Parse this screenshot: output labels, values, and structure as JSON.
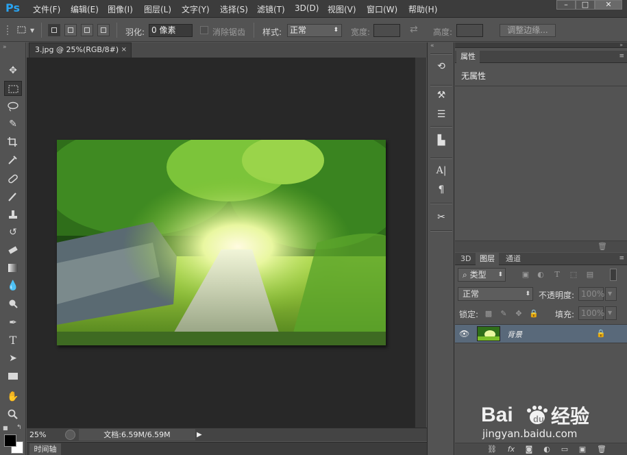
{
  "app": {
    "logo": "Ps"
  },
  "menu": [
    "文件(F)",
    "编辑(E)",
    "图像(I)",
    "图层(L)",
    "文字(Y)",
    "选择(S)",
    "滤镜(T)",
    "3D(D)",
    "视图(V)",
    "窗口(W)",
    "帮助(H)"
  ],
  "options": {
    "feather_label": "羽化:",
    "feather_value": "0 像素",
    "antialias_label": "消除锯齿",
    "style_label": "样式:",
    "style_value": "正常",
    "width_label": "宽度:",
    "height_label": "高度:",
    "refine_edge_button": "调整边缘..."
  },
  "document": {
    "tab_title": "3.jpg @ 25%(RGB/8#)",
    "close_glyph": "×",
    "image_desc_icon": "landscape-image",
    "zoom": "25%",
    "doc_size": "文档:6.59M/6.59M",
    "timeline_tab": "时间轴"
  },
  "properties_panel": {
    "tab": "属性",
    "empty_text": "无属性"
  },
  "layers_panel": {
    "tabs": [
      "3D",
      "图层",
      "通道"
    ],
    "filter_kind": "类型",
    "blend_mode": "正常",
    "opacity_label": "不透明度:",
    "opacity_value": "100%",
    "lock_label": "锁定:",
    "fill_label": "填充:",
    "fill_value": "100%",
    "layer": {
      "name": "背景"
    }
  },
  "watermark": {
    "brand": "Baidu经验",
    "url": "jingyan.baidu.com"
  },
  "colors": {
    "ps_blue": "#29a3f0",
    "selected_layer": "#59697a",
    "foreground": "#000000",
    "background": "#ffffff"
  }
}
